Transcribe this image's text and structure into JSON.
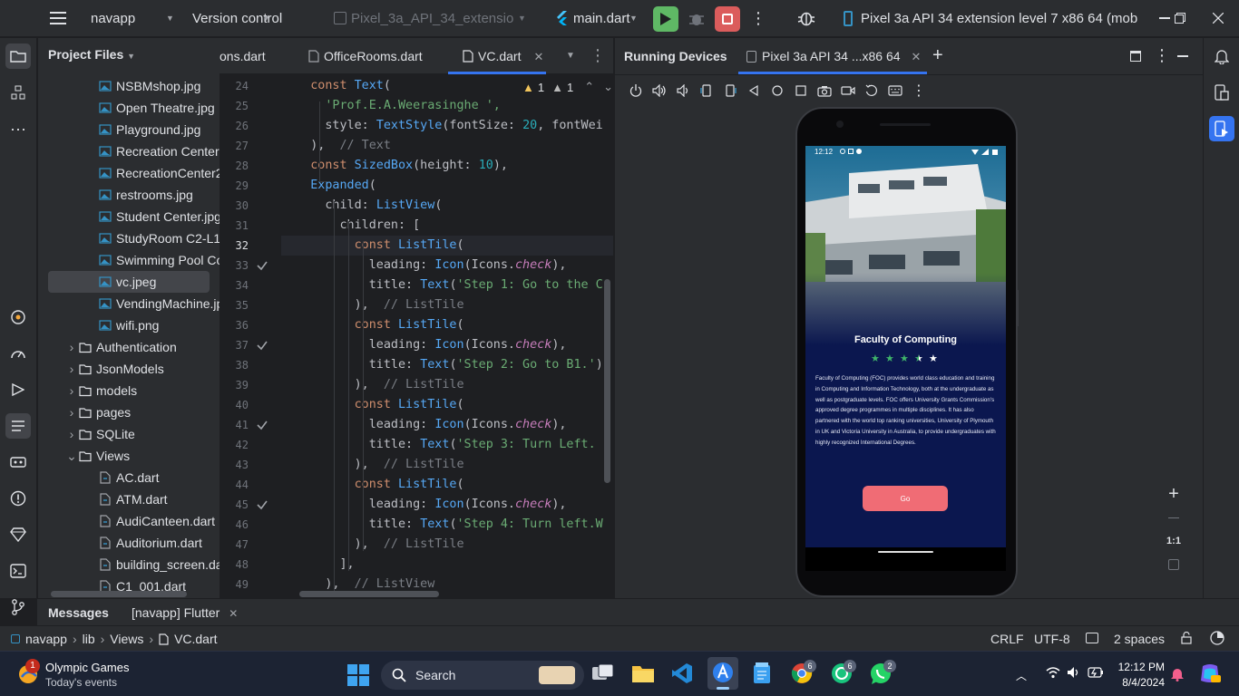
{
  "titlebar": {
    "project": "navapp",
    "vcs": "Version control",
    "device_config": "Pixel_3a_API_34_extension...",
    "run_config": "main.dart",
    "device_full": "Pixel 3a API 34 extension level 7 x86 64 (mob"
  },
  "project_panel": {
    "title": "Project Files",
    "items": [
      {
        "label": "NSBMshop.jpg",
        "type": "image",
        "indent": 2
      },
      {
        "label": "Open Theatre.jpg",
        "type": "image",
        "indent": 2
      },
      {
        "label": "Playground.jpg",
        "type": "image",
        "indent": 2
      },
      {
        "label": "Recreation Center",
        "type": "image",
        "indent": 2
      },
      {
        "label": "RecreationCenter2",
        "type": "image",
        "indent": 2
      },
      {
        "label": "restrooms.jpg",
        "type": "image",
        "indent": 2
      },
      {
        "label": "Student Center.jpg",
        "type": "image",
        "indent": 2
      },
      {
        "label": "StudyRoom C2-L11",
        "type": "image",
        "indent": 2
      },
      {
        "label": "Swimming Pool Co",
        "type": "image",
        "indent": 2
      },
      {
        "label": "vc.jpeg",
        "type": "image",
        "indent": 2,
        "selected": true
      },
      {
        "label": "VendingMachine.jp",
        "type": "image",
        "indent": 2
      },
      {
        "label": "wifi.png",
        "type": "image",
        "indent": 2
      },
      {
        "label": "Authentication",
        "type": "folder",
        "indent": 1,
        "expanded": false
      },
      {
        "label": "JsonModels",
        "type": "folder",
        "indent": 1,
        "expanded": false
      },
      {
        "label": "models",
        "type": "folder",
        "indent": 1,
        "expanded": false
      },
      {
        "label": "pages",
        "type": "folder",
        "indent": 1,
        "expanded": false
      },
      {
        "label": "SQLite",
        "type": "folder",
        "indent": 1,
        "expanded": false
      },
      {
        "label": "Views",
        "type": "folder",
        "indent": 1,
        "expanded": true
      },
      {
        "label": "AC.dart",
        "type": "dart",
        "indent": 2
      },
      {
        "label": "ATM.dart",
        "type": "dart",
        "indent": 2
      },
      {
        "label": "AudiCanteen.dart",
        "type": "dart",
        "indent": 2
      },
      {
        "label": "Auditorium.dart",
        "type": "dart",
        "indent": 2
      },
      {
        "label": "building_screen.da",
        "type": "dart",
        "indent": 2
      },
      {
        "label": "C1_001.dart",
        "type": "dart",
        "indent": 2
      }
    ]
  },
  "editor": {
    "tabs": [
      {
        "label": "ons.dart",
        "active": false
      },
      {
        "label": "OfficeRooms.dart",
        "active": false
      },
      {
        "label": "VC.dart",
        "active": true
      }
    ],
    "inspection": {
      "warnings": "1",
      "weak": "1"
    },
    "lines": [
      {
        "n": "24",
        "check": false,
        "tokens": [
          [
            "    ",
            "id"
          ],
          [
            "const ",
            "kw"
          ],
          [
            "Text",
            "cl"
          ],
          [
            "(",
            "id"
          ]
        ]
      },
      {
        "n": "25",
        "check": false,
        "tokens": [
          [
            "      ",
            "id"
          ],
          [
            "'Prof.E.A.Weerasinghe ',",
            "st"
          ]
        ]
      },
      {
        "n": "26",
        "check": false,
        "tokens": [
          [
            "      style: ",
            "id"
          ],
          [
            "TextStyle",
            "cl"
          ],
          [
            "(fontSize: ",
            "id"
          ],
          [
            "20",
            "nu"
          ],
          [
            ", fontWei",
            "id"
          ]
        ]
      },
      {
        "n": "27",
        "check": false,
        "tokens": [
          [
            "    ),  ",
            "id"
          ],
          [
            "// Text",
            "cm"
          ]
        ]
      },
      {
        "n": "28",
        "check": false,
        "tokens": [
          [
            "    ",
            "id"
          ],
          [
            "const ",
            "kw"
          ],
          [
            "SizedBox",
            "cl"
          ],
          [
            "(height: ",
            "id"
          ],
          [
            "10",
            "nu"
          ],
          [
            "),",
            "id"
          ]
        ]
      },
      {
        "n": "29",
        "check": false,
        "tokens": [
          [
            "    ",
            "id"
          ],
          [
            "Expanded",
            "cl"
          ],
          [
            "(",
            "id"
          ]
        ]
      },
      {
        "n": "30",
        "check": false,
        "tokens": [
          [
            "      child: ",
            "id"
          ],
          [
            "ListView",
            "cl"
          ],
          [
            "(",
            "id"
          ]
        ]
      },
      {
        "n": "31",
        "check": false,
        "tokens": [
          [
            "        children: [",
            "id"
          ]
        ]
      },
      {
        "n": "32",
        "check": false,
        "tokens": [
          [
            "          ",
            "id"
          ],
          [
            "const ",
            "kw"
          ],
          [
            "ListTile",
            "cl"
          ],
          [
            "(",
            "id"
          ]
        ]
      },
      {
        "n": "33",
        "check": true,
        "tokens": [
          [
            "            leading: ",
            "id"
          ],
          [
            "Icon",
            "cl"
          ],
          [
            "(Icons.",
            "id"
          ],
          [
            "check",
            "pr"
          ],
          [
            "),",
            "id"
          ]
        ]
      },
      {
        "n": "34",
        "check": false,
        "tokens": [
          [
            "            title: ",
            "id"
          ],
          [
            "Text",
            "cl"
          ],
          [
            "(",
            "id"
          ],
          [
            "'Step 1: Go to the C",
            "st"
          ]
        ]
      },
      {
        "n": "35",
        "check": false,
        "tokens": [
          [
            "          ),  ",
            "id"
          ],
          [
            "// ListTile",
            "cm"
          ]
        ]
      },
      {
        "n": "36",
        "check": false,
        "tokens": [
          [
            "          ",
            "id"
          ],
          [
            "const ",
            "kw"
          ],
          [
            "ListTile",
            "cl"
          ],
          [
            "(",
            "id"
          ]
        ]
      },
      {
        "n": "37",
        "check": true,
        "tokens": [
          [
            "            leading: ",
            "id"
          ],
          [
            "Icon",
            "cl"
          ],
          [
            "(Icons.",
            "id"
          ],
          [
            "check",
            "pr"
          ],
          [
            "),",
            "id"
          ]
        ]
      },
      {
        "n": "38",
        "check": false,
        "tokens": [
          [
            "            title: ",
            "id"
          ],
          [
            "Text",
            "cl"
          ],
          [
            "(",
            "id"
          ],
          [
            "'Step 2: Go to B1.'",
            "st"
          ],
          [
            ")",
            "id"
          ]
        ]
      },
      {
        "n": "39",
        "check": false,
        "tokens": [
          [
            "          ),  ",
            "id"
          ],
          [
            "// ListTile",
            "cm"
          ]
        ]
      },
      {
        "n": "40",
        "check": false,
        "tokens": [
          [
            "          ",
            "id"
          ],
          [
            "const ",
            "kw"
          ],
          [
            "ListTile",
            "cl"
          ],
          [
            "(",
            "id"
          ]
        ]
      },
      {
        "n": "41",
        "check": true,
        "tokens": [
          [
            "            leading: ",
            "id"
          ],
          [
            "Icon",
            "cl"
          ],
          [
            "(Icons.",
            "id"
          ],
          [
            "check",
            "pr"
          ],
          [
            "),",
            "id"
          ]
        ]
      },
      {
        "n": "42",
        "check": false,
        "tokens": [
          [
            "            title: ",
            "id"
          ],
          [
            "Text",
            "cl"
          ],
          [
            "(",
            "id"
          ],
          [
            "'Step 3: Turn Left.",
            "st"
          ]
        ]
      },
      {
        "n": "43",
        "check": false,
        "tokens": [
          [
            "          ),  ",
            "id"
          ],
          [
            "// ListTile",
            "cm"
          ]
        ]
      },
      {
        "n": "44",
        "check": false,
        "tokens": [
          [
            "          ",
            "id"
          ],
          [
            "const ",
            "kw"
          ],
          [
            "ListTile",
            "cl"
          ],
          [
            "(",
            "id"
          ]
        ]
      },
      {
        "n": "45",
        "check": true,
        "tokens": [
          [
            "            leading: ",
            "id"
          ],
          [
            "Icon",
            "cl"
          ],
          [
            "(Icons.",
            "id"
          ],
          [
            "check",
            "pr"
          ],
          [
            "),",
            "id"
          ]
        ]
      },
      {
        "n": "46",
        "check": false,
        "tokens": [
          [
            "            title: ",
            "id"
          ],
          [
            "Text",
            "cl"
          ],
          [
            "(",
            "id"
          ],
          [
            "'Step 4: Turn left.W",
            "st"
          ]
        ]
      },
      {
        "n": "47",
        "check": false,
        "tokens": [
          [
            "          ),  ",
            "id"
          ],
          [
            "// ListTile",
            "cm"
          ]
        ]
      },
      {
        "n": "48",
        "check": false,
        "tokens": [
          [
            "        ],",
            "id"
          ]
        ]
      },
      {
        "n": "49",
        "check": false,
        "tokens": [
          [
            "      ),  ",
            "id"
          ],
          [
            "// ListView",
            "cm"
          ]
        ]
      }
    ]
  },
  "running_devices": {
    "title": "Running Devices",
    "device_tab": "Pixel 3a API 34 ...x86 64",
    "zoom_label": "1:1",
    "phone": {
      "time": "12:12",
      "heading": "Faculty of Computing",
      "rating": 3.5,
      "stars_total": 5,
      "description": "Faculty of Computing (FOC) provides world class education and training in Computing and Information Technology, both at the undergraduate as well as postgraduate levels. FOC offers University Grants Commission's approved degree programmes in multiple disciplines. It has also partnered with the world top ranking universities, University of Plymouth in UK and Victoria University in Australia, to provide undergraduates with highly recognized International Degrees.",
      "button": "Go"
    }
  },
  "bottom": {
    "messages": "Messages",
    "flutter_tab": "[navapp] Flutter"
  },
  "status": {
    "crumbs": [
      "navapp",
      "lib",
      "Views",
      "VC.dart"
    ],
    "line_sep": "CRLF",
    "encoding": "UTF-8",
    "indent": "2 spaces"
  },
  "taskbar": {
    "widget_title": "Olympic Games",
    "widget_sub": "Today's events",
    "widget_badge": "1",
    "search": "Search",
    "time": "12:12 PM",
    "date": "8/4/2024",
    "chrome_badge": "6",
    "chatgpt_badge": "6",
    "whatsapp_badge": "2"
  },
  "colors": {
    "accent": "#3574f0",
    "run_green": "#5fb865",
    "stop_red": "#db5c5c",
    "go_button": "#f06c75"
  }
}
